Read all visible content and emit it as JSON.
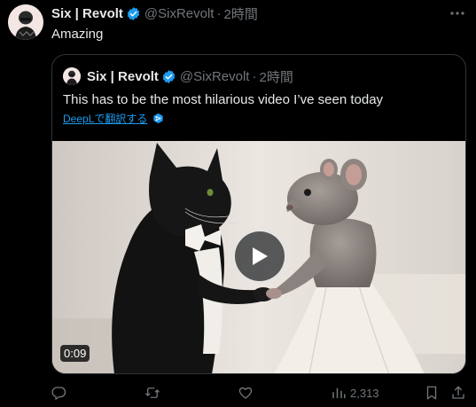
{
  "tweet": {
    "author_name": "Six | Revolt",
    "handle": "@SixRevolt",
    "separator": "·",
    "time": "2時間",
    "text": "Amazing"
  },
  "quote": {
    "author_name": "Six | Revolt",
    "handle": "@SixRevolt",
    "separator": "·",
    "time": "2時間",
    "text": "This has to be the most hilarious video I’ve seen today",
    "translate_label": "DeepLで翻訳する",
    "video_duration": "0:09"
  },
  "actions": {
    "views_count": "2,313"
  },
  "colors": {
    "background": "#000000",
    "text_primary": "#e7e9ea",
    "text_secondary": "#71767b",
    "accent": "#1d9bf0",
    "border": "#2f3336"
  },
  "icons": [
    "more-icon",
    "verified-icon",
    "reply-icon",
    "retweet-icon",
    "like-icon",
    "views-icon",
    "bookmark-icon",
    "share-icon",
    "play-icon",
    "deepl-icon"
  ]
}
